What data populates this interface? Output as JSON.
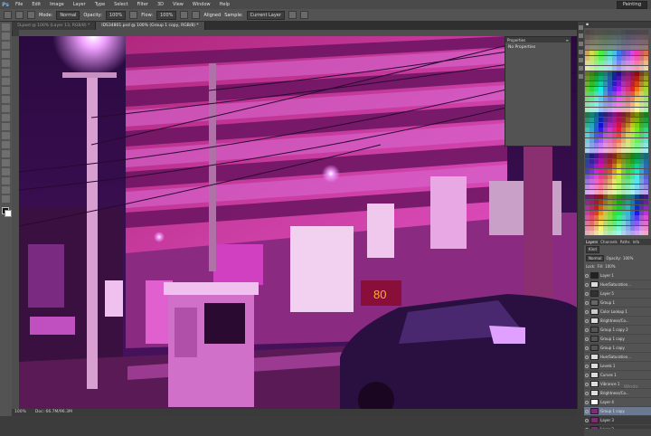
{
  "menubar": {
    "logo": "Ps",
    "items": [
      "File",
      "Edit",
      "Image",
      "Layer",
      "Type",
      "Select",
      "Filter",
      "3D",
      "View",
      "Window",
      "Help"
    ],
    "workspace": "Painting"
  },
  "options": {
    "mode_label": "Mode:",
    "mode_value": "Normal",
    "opacity_label": "Opacity:",
    "opacity_value": "100%",
    "flow_label": "Flow:",
    "flow_value": "100%",
    "aligned_label": "Aligned",
    "sample_label": "Sample:",
    "sample_value": "Current Layer"
  },
  "tabs": [
    {
      "label": "5Lpwd @ 100% (Layer 13, RGB/8) *"
    },
    {
      "label": "IDS34801.psd @ 100% (Group 1 copy, RGB/8) *"
    }
  ],
  "properties": {
    "title": "Properties",
    "body": "No Properties"
  },
  "layers_panel": {
    "tabs": [
      "Layers",
      "Channels",
      "Paths",
      "Info"
    ],
    "filter": "Kind",
    "blend": "Normal",
    "opacity_label": "Opacity:",
    "opacity_value": "100%",
    "lock_label": "Lock:",
    "fill_label": "Fill:",
    "fill_value": "100%",
    "layers": [
      {
        "name": "Layer 1",
        "thumb": "#222"
      },
      {
        "name": "Hue/Saturation...",
        "thumb": "#ddd"
      },
      {
        "name": "Layer 5",
        "thumb": "#333"
      },
      {
        "name": "Group 1",
        "thumb": "#666"
      },
      {
        "name": "Color Lookup 1",
        "thumb": "#ccc"
      },
      {
        "name": "Brightness/Co...",
        "thumb": "#ddd"
      },
      {
        "name": "Group 1 copy 2",
        "thumb": "#555"
      },
      {
        "name": "Group 1 copy",
        "thumb": "#555"
      },
      {
        "name": "Group 1 copy",
        "thumb": "#555"
      },
      {
        "name": "Hue/Saturation...",
        "thumb": "#ddd"
      },
      {
        "name": "Levels 1",
        "thumb": "#ddd"
      },
      {
        "name": "Curves 1",
        "thumb": "#ddd"
      },
      {
        "name": "Vibrance 1",
        "thumb": "#ddd"
      },
      {
        "name": "Brightness/Co...",
        "thumb": "#ddd"
      },
      {
        "name": "Layer 4",
        "thumb": "#fff"
      },
      {
        "name": "Group 1 copy",
        "thumb": "#7a3070"
      },
      {
        "name": "Layer 3",
        "thumb": "#7a3070"
      },
      {
        "name": "Layer 2",
        "thumb": "#7a3070"
      },
      {
        "name": "Group 1 copy",
        "thumb": "#7a3070"
      }
    ]
  },
  "status": {
    "zoom": "100%",
    "doc": "Doc: 66.7M/96.3M"
  },
  "canvas": {
    "sign_text": "80"
  },
  "watermark": "Windo",
  "colors": {
    "accent": "#6a7890",
    "neon": "#e43fc4"
  }
}
